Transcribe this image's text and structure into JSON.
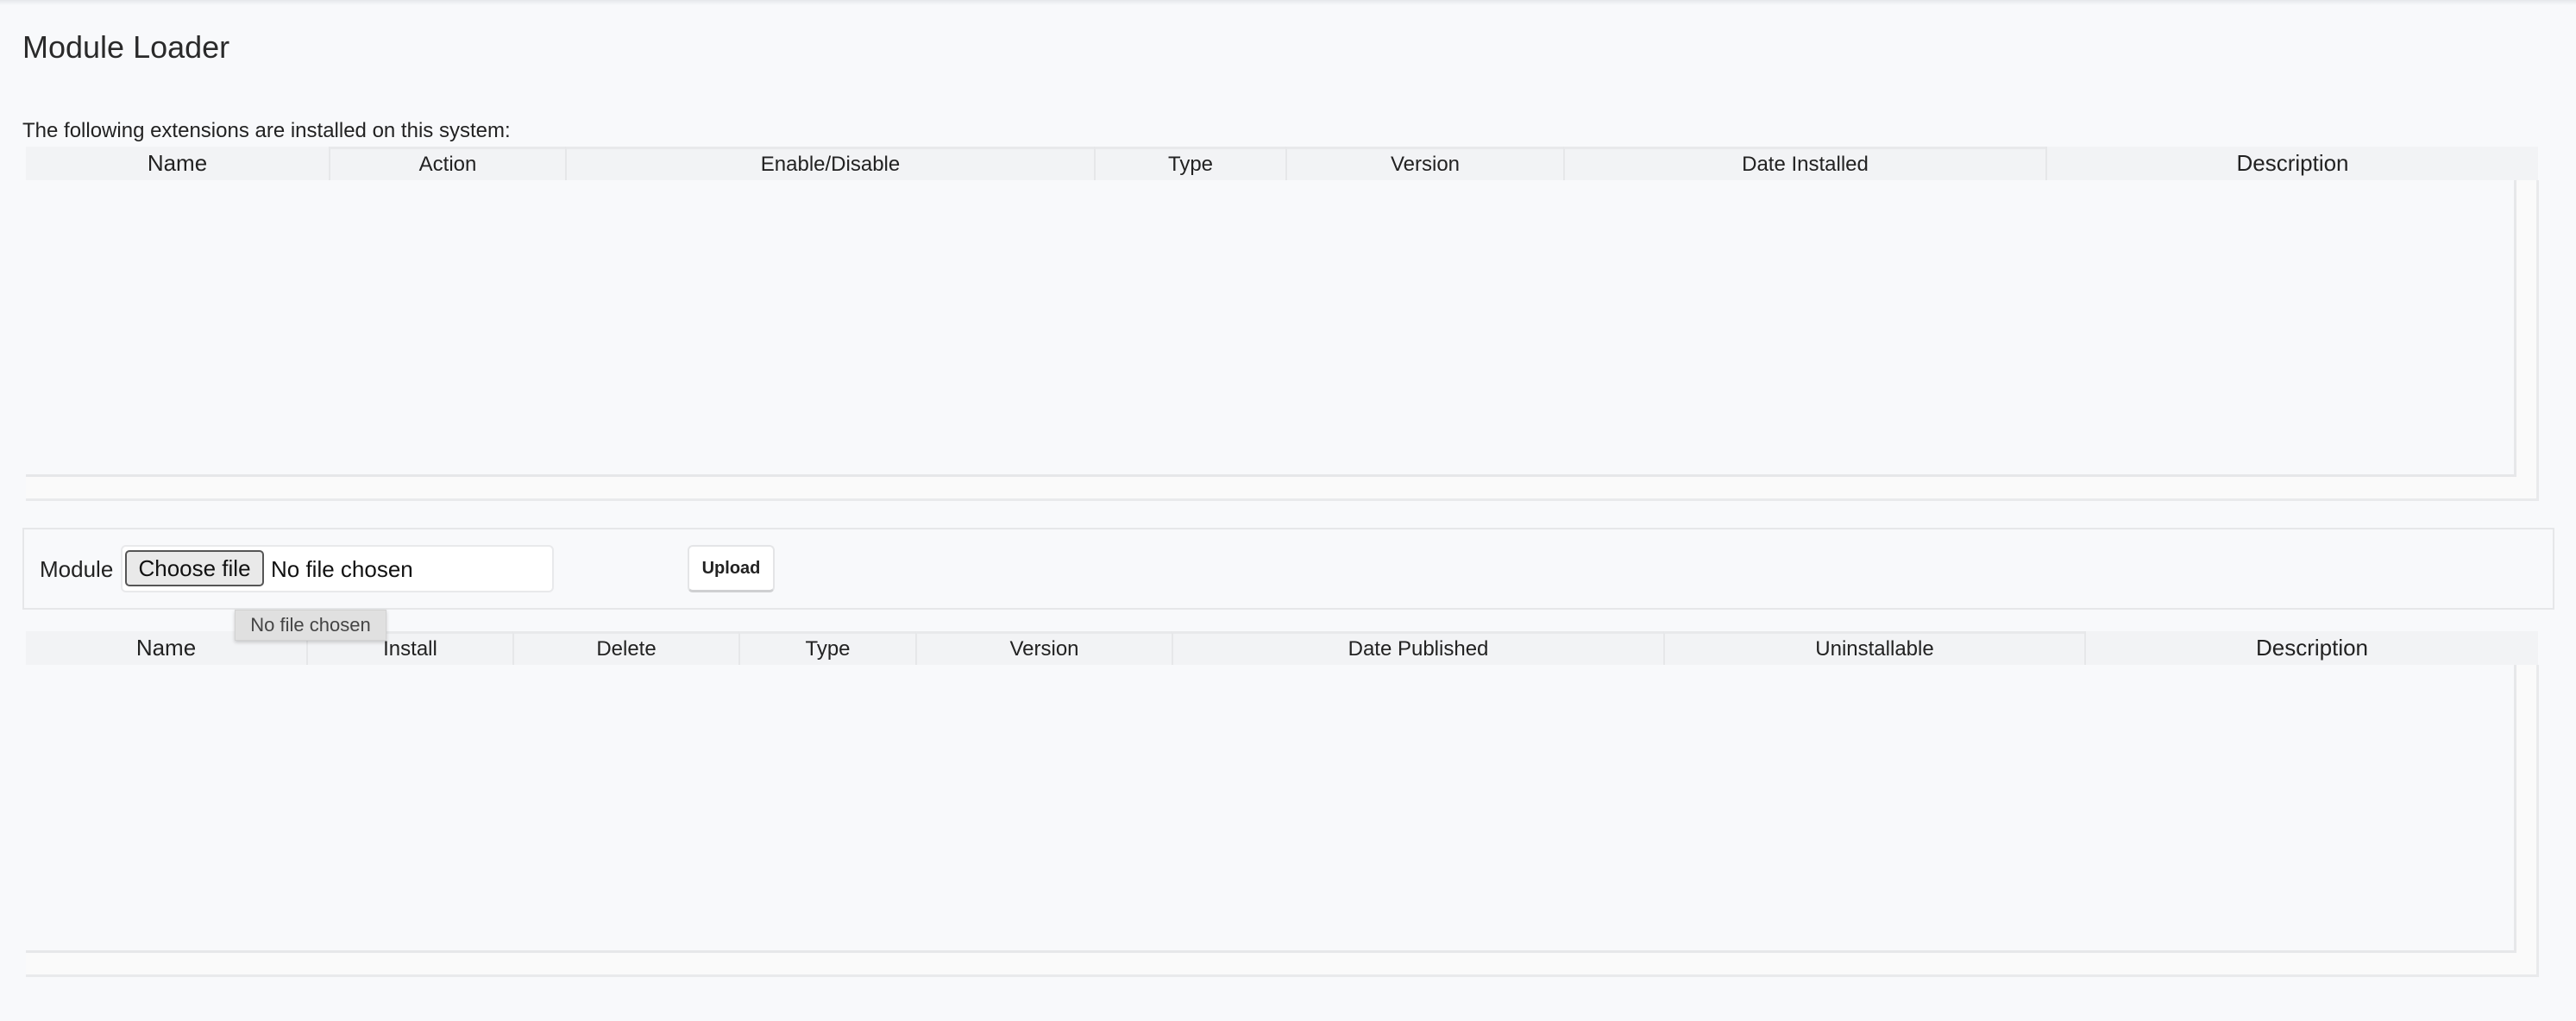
{
  "page": {
    "title": "Module Loader",
    "installed_intro": "The following extensions are installed on this system:"
  },
  "installed_table": {
    "columns": [
      {
        "label": "Name"
      },
      {
        "label": "Action"
      },
      {
        "label": "Enable/Disable"
      },
      {
        "label": "Type"
      },
      {
        "label": "Version"
      },
      {
        "label": "Date Installed"
      },
      {
        "label": "Description"
      }
    ],
    "rows": []
  },
  "upload": {
    "module_label": "Module",
    "choose_file_label": "Choose file",
    "file_status": "No file chosen",
    "upload_label": "Upload",
    "tooltip": "No file chosen"
  },
  "available_table": {
    "columns": [
      {
        "label": "Name"
      },
      {
        "label": "Install"
      },
      {
        "label": "Delete"
      },
      {
        "label": "Type"
      },
      {
        "label": "Version"
      },
      {
        "label": "Date Published"
      },
      {
        "label": "Uninstallable"
      },
      {
        "label": "Description"
      }
    ],
    "rows": []
  }
}
